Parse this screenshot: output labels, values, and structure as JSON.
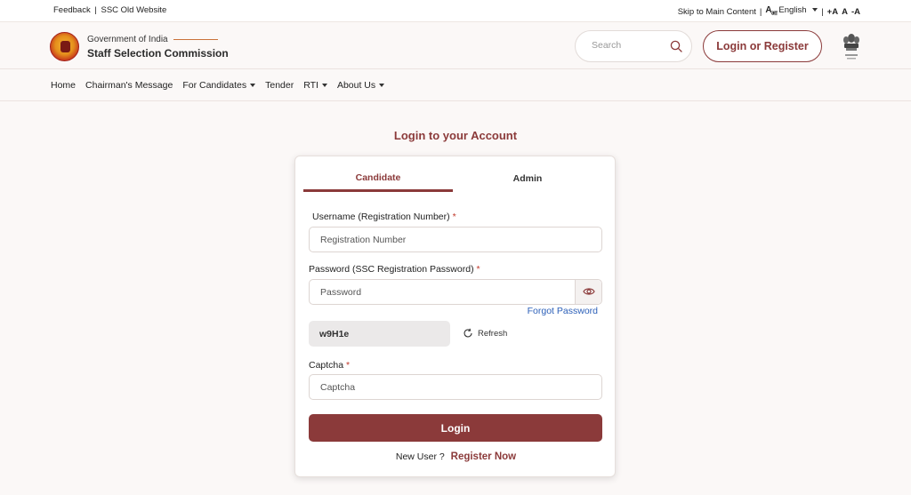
{
  "topbar": {
    "feedback": "Feedback",
    "separator": "|",
    "old_website": "SSC Old Website",
    "skip": "Skip to Main Content",
    "lang_glyph": "A",
    "lang_glyph_sub": "आ",
    "language": "English",
    "font_increase": "+A",
    "font_normal": "A",
    "font_decrease": "-A"
  },
  "header": {
    "gov": "Government of India",
    "org": "Staff Selection Commission",
    "search_placeholder": "Search",
    "login_register": "Login or Register"
  },
  "nav": {
    "items": [
      {
        "label": "Home",
        "dropdown": false
      },
      {
        "label": "Chairman's Message",
        "dropdown": false
      },
      {
        "label": "For Candidates",
        "dropdown": true
      },
      {
        "label": "Tender",
        "dropdown": false
      },
      {
        "label": "RTI",
        "dropdown": true
      },
      {
        "label": "About Us",
        "dropdown": true
      }
    ]
  },
  "login": {
    "title": "Login to your Account",
    "tabs": [
      "Candidate",
      "Admin"
    ],
    "active_tab": "Candidate",
    "username_label": "Username (Registration Number)",
    "username_placeholder": "Registration Number",
    "password_label": "Password (SSC Registration Password)",
    "password_placeholder": "Password",
    "required_mark": "*",
    "forgot": "Forgot Password",
    "captcha_code": "w9H1e",
    "refresh": "Refresh",
    "captcha_label": "Captcha",
    "captcha_placeholder": "Captcha",
    "login_button": "Login",
    "new_user": "New User ?",
    "register_now": "Register Now"
  },
  "colors": {
    "brand": "#8b3a3a",
    "link": "#2b5fb8",
    "required": "#c0392b"
  }
}
